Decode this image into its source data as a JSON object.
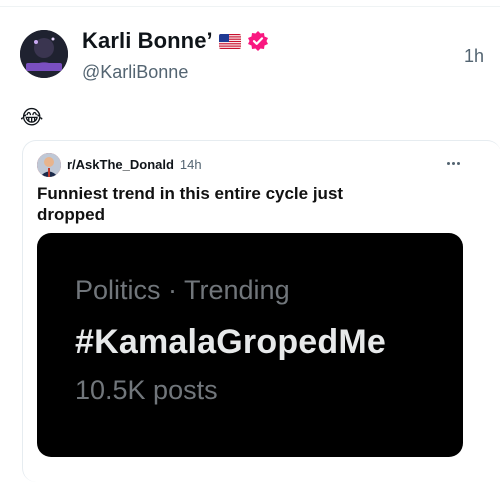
{
  "tweet": {
    "display_name": "Karli Bonne’",
    "handle": "@KarliBonne",
    "timestamp": "1h",
    "text": "😂",
    "flag_icon": "us-flag-icon",
    "verified_icon": "verified-badge-icon",
    "verified_color": "#f91880"
  },
  "embed": {
    "subreddit": "r/AskThe_Donald",
    "time": "14h",
    "title": "Funniest trend in this entire cycle just dropped",
    "trend": {
      "context": "Politics · Trending",
      "hashtag": "#KamalaGropedMe",
      "count": "10.5K posts"
    }
  }
}
